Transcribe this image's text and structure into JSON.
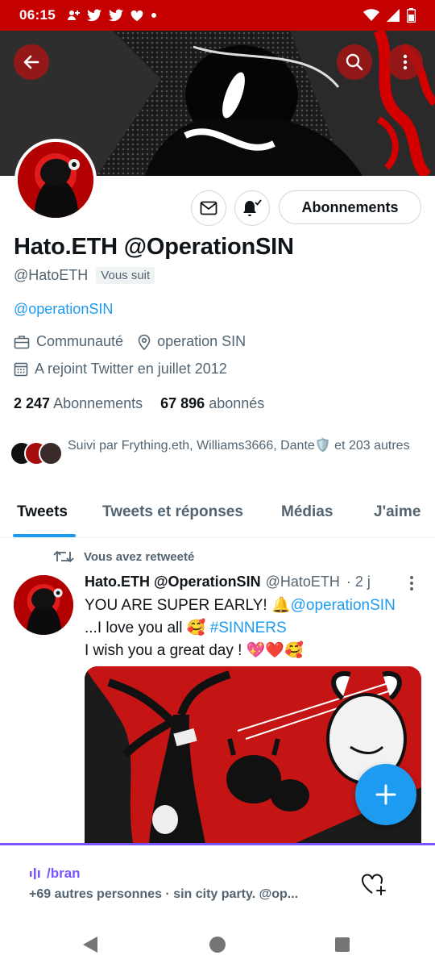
{
  "status_bar": {
    "time": "06:15"
  },
  "profile": {
    "display_name": "Hato.ETH @OperationSIN",
    "handle": "@HatoETH",
    "follows_you": "Vous suit",
    "bio_link": "@operationSIN",
    "category": "Communauté",
    "location": "operation SIN",
    "joined": "A rejoint Twitter en juillet 2012",
    "following_count": "2 247",
    "following_label": "Abonnements",
    "followers_count": "67 896",
    "followers_label": "abonnés",
    "followed_by": "Suivi par Frything.eth, Williams3666, Dante🛡️ et 203 autres"
  },
  "actions": {
    "follow_button": "Abonnements"
  },
  "tabs": [
    {
      "label": "Tweets"
    },
    {
      "label": "Tweets et réponses"
    },
    {
      "label": "Médias"
    },
    {
      "label": "J'aime"
    }
  ],
  "tweet": {
    "retweet_label": "Vous avez retweeté",
    "author_name": "Hato.ETH @OperationSIN",
    "author_handle": "@HatoETH",
    "time": "· 2 j",
    "line1_text": "YOU ARE SUPER EARLY! 🔔",
    "line1_link": "@operationSIN",
    "line2_text": " ...I love you all 🥰",
    "line2_link": "#SINNERS",
    "line3_text": "I wish you a great day ! 💖❤️🥰"
  },
  "player": {
    "title": "/bran",
    "subtitle": "+69 autres personnes · sin city party. @op..."
  },
  "colors": {
    "status_bar": "#c40000",
    "accent": "#1d9bf0",
    "spaces_purple": "#7856ff"
  }
}
